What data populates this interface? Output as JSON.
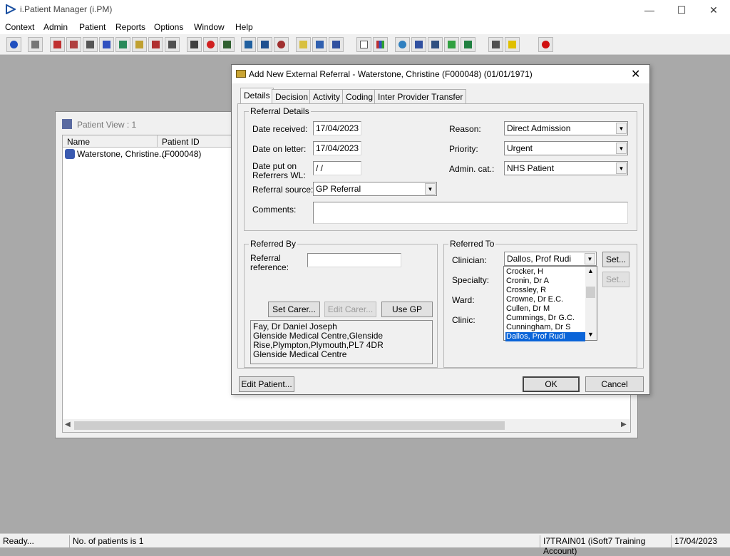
{
  "window": {
    "title": "i.Patient Manager (i.PM)",
    "minimize": "—",
    "maximize": "☐",
    "close": "✕"
  },
  "menu": [
    "Context",
    "Admin",
    "Patient",
    "Reports",
    "Options",
    "Window",
    "Help"
  ],
  "patient_view": {
    "title": "Patient View : 1",
    "columns": [
      "Name",
      "Patient ID"
    ],
    "rows": [
      {
        "name": "Waterstone, Christine...",
        "id": "(F000048)"
      }
    ]
  },
  "dialog": {
    "title": "Add New External Referral - Waterstone, Christine (F000048) (01/01/1971)",
    "close": "✕",
    "tabs": [
      "Details",
      "Decision",
      "Activity",
      "Coding",
      "Inter Provider Transfer"
    ],
    "referral_details": {
      "legend": "Referral Details",
      "date_received_label": "Date received:",
      "date_received": "17/04/2023",
      "date_on_letter_label": "Date on letter:",
      "date_on_letter": "17/04/2023",
      "date_put_on_label_1": "Date put on",
      "date_put_on_label_2": "Referrers WL:",
      "date_put_on": " /  /",
      "referral_source_label": "Referral source:",
      "referral_source": "GP Referral",
      "reason_label": "Reason:",
      "reason": "Direct Admission",
      "priority_label": "Priority:",
      "priority": "Urgent",
      "admin_cat_label": "Admin. cat.:",
      "admin_cat": "NHS Patient",
      "comments_label": "Comments:",
      "comments": ""
    },
    "referred_by": {
      "legend": "Referred By",
      "ref_label_1": "Referral",
      "ref_label_2": "reference:",
      "reference": "",
      "set_carer": "Set Carer...",
      "edit_carer": "Edit Carer...",
      "use_gp": "Use GP",
      "gp_lines": [
        "Fay, Dr Daniel Joseph",
        "Glenside Medical Centre,Glenside",
        "Rise,Plympton,Plymouth,PL7 4DR",
        "Glenside Medical Centre"
      ]
    },
    "referred_to": {
      "legend": "Referred To",
      "clinician_label": "Clinician:",
      "clinician": "Dallos, Prof Rudi",
      "specialty_label": "Specialty:",
      "ward_label": "Ward:",
      "clinic_label": "Clinic:",
      "set_label": "Set...",
      "clinician_options": [
        "Crocker, H",
        "Cronin, Dr A",
        "Crossley, R",
        "Crowne, Dr E.C.",
        "Cullen, Dr M",
        "Cummings, Dr G.C.",
        "Cunningham, Dr S",
        "Dallos, Prof Rudi"
      ],
      "selected_index": 7
    },
    "edit_patient": "Edit Patient...",
    "ok": "OK",
    "cancel": "Cancel"
  },
  "status": {
    "ready": "Ready...",
    "count": "No. of patients is 1",
    "account": "I7TRAIN01 (iSoft7 Training Account)",
    "date": "17/04/2023"
  }
}
